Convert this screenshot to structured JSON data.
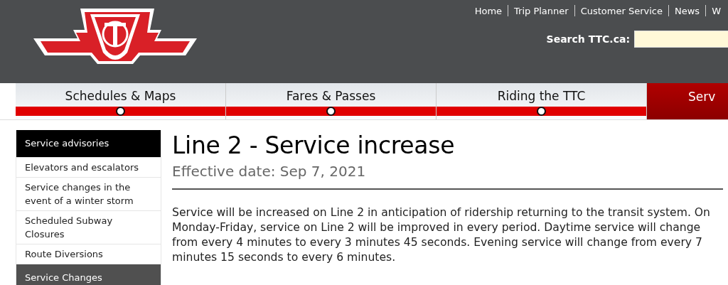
{
  "top_links": [
    "Home",
    "Trip Planner",
    "Customer Service",
    "News",
    "W"
  ],
  "search": {
    "label": "Search TTC.ca:"
  },
  "tabs": [
    {
      "label": "Schedules & Maps",
      "selected": false
    },
    {
      "label": "Fares & Passes",
      "selected": false
    },
    {
      "label": "Riding the TTC",
      "selected": false
    },
    {
      "label": "Serv",
      "selected": true
    }
  ],
  "sidebar": {
    "items": [
      {
        "label": "Service advisories",
        "kind": "header",
        "selected": true
      },
      {
        "label": "Elevators and escalators",
        "kind": "link",
        "selected": false
      },
      {
        "label": "Service changes in the event of a winter storm",
        "kind": "link",
        "selected": false
      },
      {
        "label": "Scheduled Subway Closures",
        "kind": "link",
        "selected": false
      },
      {
        "label": "Route Diversions",
        "kind": "link",
        "selected": false
      },
      {
        "label": "Service Changes",
        "kind": "header",
        "selected": false
      }
    ]
  },
  "article": {
    "title": "Line 2 - Service increase",
    "effective_date": "Effective date: Sep 7, 2021",
    "body": "Service will be increased on Line 2 in anticipation of ridership returning to the transit system. On Monday-Friday, service on Line 2 will be improved in every period. Daytime service will change from every 4 minutes to every 3 minutes 45 seconds. Evening service will change from every 7 minutes 15 seconds to every 6 minutes."
  }
}
